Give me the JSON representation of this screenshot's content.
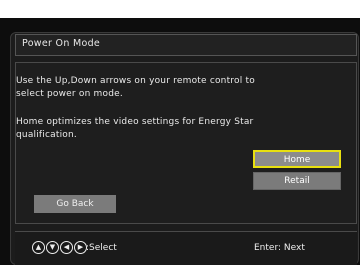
{
  "menu": {
    "title": "Power On Mode"
  },
  "message": {
    "line1": "Use the Up,Down arrows on your remote control to",
    "line2": "select power on mode.",
    "line3": "Home optimizes the video settings for Energy Star",
    "line4": "qualification."
  },
  "options": {
    "home": "Home",
    "retail": "Retail"
  },
  "go_back": "Go Back",
  "footer": {
    "nav_icons": [
      "up-arrow-icon",
      "down-arrow-icon",
      "left-arrow-icon",
      "right-arrow-icon"
    ],
    "select_label": ":Select",
    "enter_label": "Enter: Next"
  },
  "colors": {
    "highlight": "#e8e010",
    "button": "#7b7b7b",
    "background": "#0d0d0d"
  }
}
